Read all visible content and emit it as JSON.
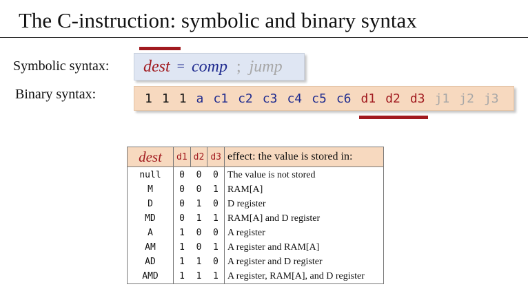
{
  "title": "The C-instruction:  symbolic  and binary  syntax",
  "symbolic": {
    "label": "Symbolic syntax:",
    "dest": "dest",
    "eq": "=",
    "comp": "comp",
    "semi": ";",
    "jump": "jump"
  },
  "binary": {
    "label": "Binary syntax:",
    "bits": [
      {
        "text": "1",
        "color": "#111111"
      },
      {
        "text": "1",
        "color": "#111111"
      },
      {
        "text": "1",
        "color": "#111111"
      },
      {
        "text": "a",
        "color": "#1f2b8f"
      },
      {
        "text": "c1",
        "color": "#1f2b8f"
      },
      {
        "text": "c2",
        "color": "#1f2b8f"
      },
      {
        "text": "c3",
        "color": "#1f2b8f"
      },
      {
        "text": "c4",
        "color": "#1f2b8f"
      },
      {
        "text": "c5",
        "color": "#1f2b8f"
      },
      {
        "text": "c6",
        "color": "#1f2b8f"
      },
      {
        "text": "d1",
        "color": "#a11a1f"
      },
      {
        "text": "d2",
        "color": "#a11a1f"
      },
      {
        "text": "d3",
        "color": "#a11a1f"
      },
      {
        "text": "j1",
        "color": "#a7a7a7"
      },
      {
        "text": "j2",
        "color": "#a7a7a7"
      },
      {
        "text": "j3",
        "color": "#a7a7a7"
      }
    ]
  },
  "table": {
    "headers": {
      "dest": "dest",
      "d1": "d1",
      "d2": "d2",
      "d3": "d3",
      "effect": "effect: the value is stored in:"
    },
    "rows": [
      {
        "dest": "null",
        "d1": "0",
        "d2": "0",
        "d3": "0",
        "effect": "The value is not stored"
      },
      {
        "dest": "M",
        "d1": "0",
        "d2": "0",
        "d3": "1",
        "effect": "RAM[A]"
      },
      {
        "dest": "D",
        "d1": "0",
        "d2": "1",
        "d3": "0",
        "effect": "D register"
      },
      {
        "dest": "MD",
        "d1": "0",
        "d2": "1",
        "d3": "1",
        "effect": "RAM[A]  and D register"
      },
      {
        "dest": "A",
        "d1": "1",
        "d2": "0",
        "d3": "0",
        "effect": "A register"
      },
      {
        "dest": "AM",
        "d1": "1",
        "d2": "0",
        "d3": "1",
        "effect": "A register and RAM[A]"
      },
      {
        "dest": "AD",
        "d1": "1",
        "d2": "1",
        "d3": "0",
        "effect": "A register and D register"
      },
      {
        "dest": "AMD",
        "d1": "1",
        "d2": "1",
        "d3": "1",
        "effect": "A register,  RAM[A],  and D register"
      }
    ]
  },
  "colors": {
    "accent_red": "#a11a1f",
    "comp_blue": "#1f2b8f",
    "jump_gray": "#a7a7a7",
    "symbolic_bg": "#dfe6f3",
    "binary_bg": "#f7d9bf"
  }
}
